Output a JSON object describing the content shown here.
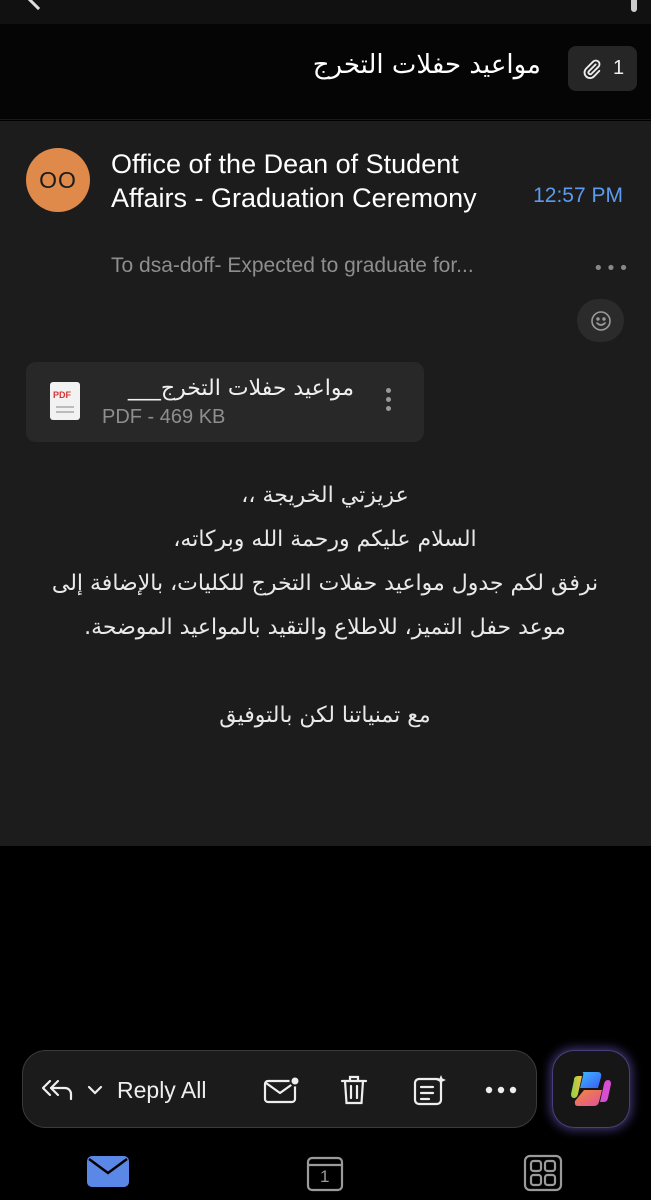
{
  "header": {
    "subject": "مواعيد حفلات التخرج",
    "attachment_count": "1",
    "back_icon": "chevron-left-icon"
  },
  "message": {
    "avatar_initials": "OO",
    "sender": "Office of the Dean of Student Affairs - Graduation Ceremony",
    "time": "12:57 PM",
    "to_line": "To dsa-doff- Expected to graduate for...",
    "more_icon": "ellipsis-icon",
    "reaction_icon": "smiley-icon"
  },
  "attachment": {
    "name": "مواعيد حفلات التخرج___",
    "meta": "PDF - 469 KB",
    "icon_label": "PDF"
  },
  "body": {
    "line1": "عزيزتي الخريجة ،،",
    "line2": "السلام عليكم ورحمة الله وبركاته،",
    "line3": "نرفق لكم جدول مواعيد حفلات التخرج للكليات، بالإضافة إلى",
    "line4": "موعد حفل التميز، للاطلاع والتقيد بالمواعيد الموضحة.",
    "line5": "مع تمنياتنا لكن بالتوفيق"
  },
  "actions": {
    "reply_all_label": "Reply All",
    "icons": [
      "reply-all-icon",
      "chevron-down-icon",
      "mark-unread-icon",
      "trash-icon",
      "summarize-icon",
      "more-icon",
      "copilot-icon"
    ]
  },
  "tabs": {
    "calendar_day": "1",
    "icons": [
      "mail-icon",
      "calendar-icon",
      "apps-icon"
    ]
  },
  "colors": {
    "accent": "#5b9bf0",
    "avatar": "#df8a4a",
    "card": "#1c1c1c"
  }
}
